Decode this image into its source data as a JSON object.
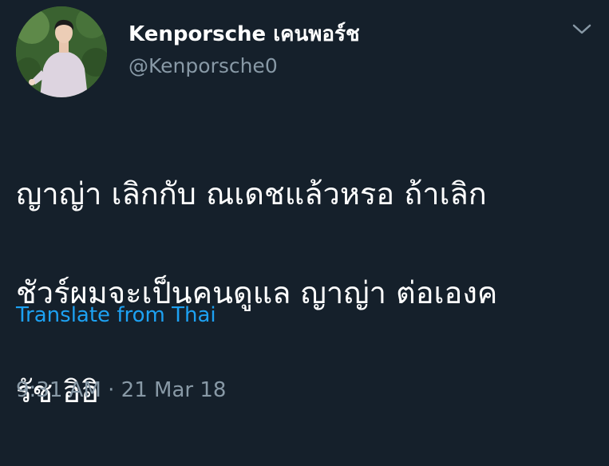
{
  "tweet": {
    "display_name": "Kenporsche เคนพอร์ช",
    "handle": "@Kenporsche0",
    "text_lines": [
      "ญาญ่า เลิกกับ ณเดชแล้วหรอ ถ้าเลิก",
      "ชัวร์ผมจะเป็นคนดูแล ญาญ่า ต่อเองค",
      "รัช อิอิ"
    ],
    "translate_label": "Translate from Thai",
    "timestamp": "9:31 AM · 21 Mar 18",
    "menu_icon": "chevron-down-icon",
    "avatar": "profile-photo"
  },
  "colors": {
    "background": "#15202b",
    "text": "#ffffff",
    "secondary": "#8899a6",
    "link": "#1da1f2"
  }
}
